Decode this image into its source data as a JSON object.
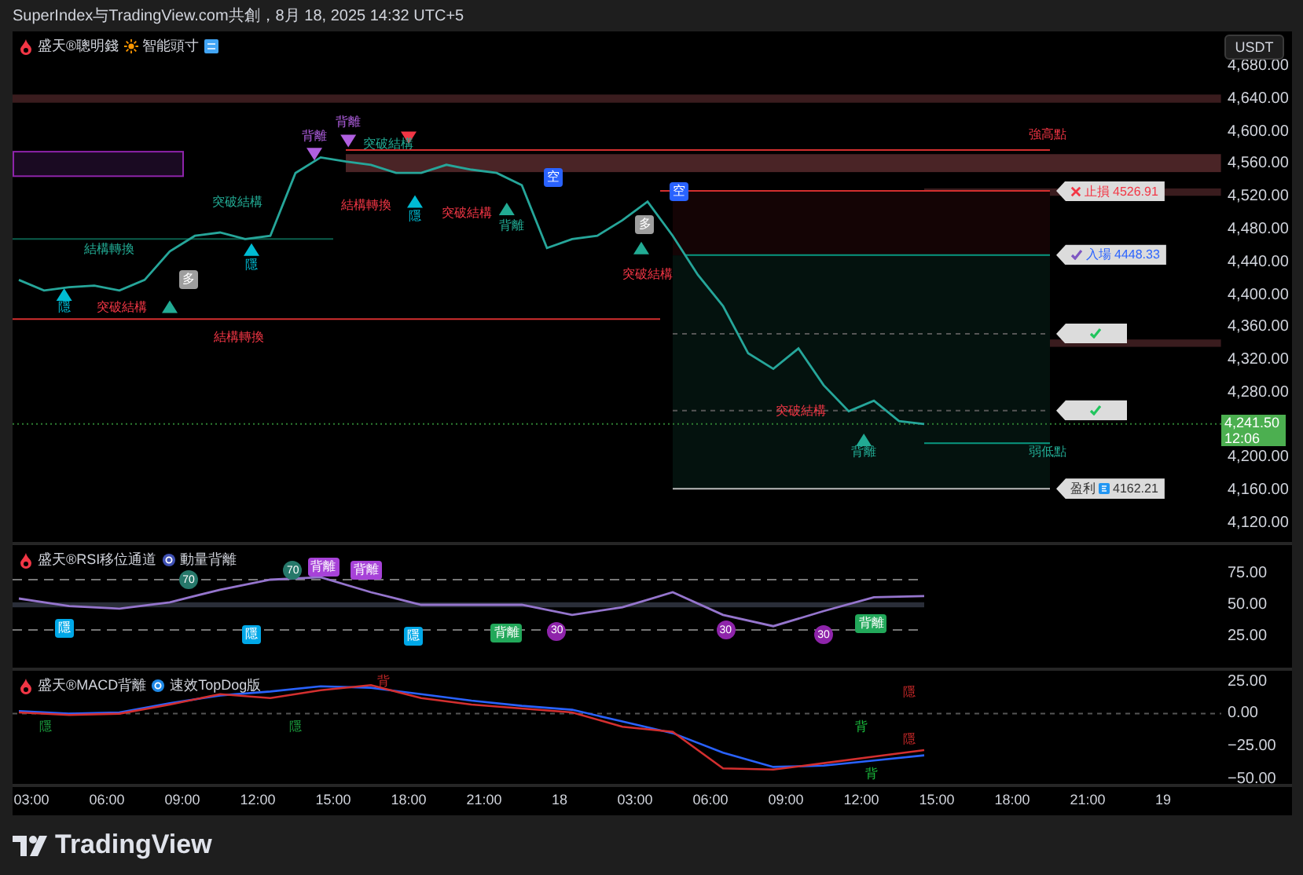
{
  "header": {
    "text": "SuperIndex与TradingView.com共創，8月 18, 2025 14:32 UTC+5"
  },
  "price_panel": {
    "legend": {
      "name": "盛天®聰明錢",
      "setting": "智能頭寸"
    },
    "currency_button": "USDT",
    "price_tag": {
      "price": "4,241.50",
      "countdown": "12:06"
    },
    "axis_labels": [
      "4,680.00",
      "4,640.00",
      "4,600.00",
      "4,560.00",
      "4,520.00",
      "4,480.00",
      "4,440.00",
      "4,400.00",
      "4,360.00",
      "4,320.00",
      "4,280.00",
      "4,200.00",
      "4,160.00",
      "4,120.00"
    ],
    "signals": [
      {
        "kind": "label",
        "text": "背離",
        "color": "#b05fe0"
      },
      {
        "kind": "down-arrow",
        "color": "#b05fe0"
      },
      {
        "kind": "label",
        "text": "背離",
        "color": "#b05fe0"
      },
      {
        "kind": "down-arrow",
        "color": "#b05fe0"
      },
      {
        "kind": "label",
        "text": "突破結構",
        "color": "#22ab94"
      },
      {
        "kind": "down-arrow",
        "color": "#f23645"
      },
      {
        "kind": "label",
        "text": "突破結構",
        "color": "#22ab94"
      },
      {
        "kind": "label",
        "text": "結構轉換",
        "color": "#22ab94"
      },
      {
        "kind": "up-arrow",
        "color": "#00bcd4"
      },
      {
        "kind": "label",
        "text": "隱",
        "color": "#00bcd4"
      },
      {
        "kind": "label",
        "text": "突破結構",
        "color": "#f23645"
      },
      {
        "kind": "up-arrow",
        "color": "#22ab94"
      },
      {
        "kind": "tag",
        "text": "多",
        "color": "#9e9e9e"
      },
      {
        "kind": "up-arrow",
        "color": "#00bcd4"
      },
      {
        "kind": "label",
        "text": "隱",
        "color": "#00bcd4"
      },
      {
        "kind": "label",
        "text": "結構轉換",
        "color": "#f23645"
      },
      {
        "kind": "label",
        "text": "結構轉換",
        "color": "#f23645"
      },
      {
        "kind": "up-arrow",
        "color": "#00bcd4"
      },
      {
        "kind": "label",
        "text": "隱",
        "color": "#00bcd4"
      },
      {
        "kind": "label",
        "text": "突破結構",
        "color": "#f23645"
      },
      {
        "kind": "up-arrow",
        "color": "#22ab94"
      },
      {
        "kind": "label",
        "text": "背離",
        "color": "#22ab94"
      },
      {
        "kind": "tag",
        "text": "空",
        "color": "#2962ff"
      },
      {
        "kind": "tag",
        "text": "多",
        "color": "#9e9e9e"
      },
      {
        "kind": "up-arrow",
        "color": "#22ab94"
      },
      {
        "kind": "tag",
        "text": "空",
        "color": "#2962ff"
      },
      {
        "kind": "label",
        "text": "突破結構",
        "color": "#f23645"
      },
      {
        "kind": "label",
        "text": "突破結構",
        "color": "#f23645"
      },
      {
        "kind": "up-arrow",
        "color": "#22ab94"
      },
      {
        "kind": "label",
        "text": "背離",
        "color": "#22ab94"
      },
      {
        "kind": "label",
        "text": "強高點",
        "color": "#f23645"
      },
      {
        "kind": "label",
        "text": "弱低點",
        "color": "#22ab94"
      }
    ],
    "level_tags": [
      {
        "kind": "stop",
        "label": "止損",
        "value": "4526.91"
      },
      {
        "kind": "entry",
        "label": "入場",
        "value": "4448.33"
      },
      {
        "kind": "target"
      },
      {
        "kind": "target"
      },
      {
        "kind": "profit",
        "label": "盈利",
        "value": "4162.21"
      }
    ]
  },
  "rsi_panel": {
    "legend": {
      "name": "盛天®RSI移位通道",
      "setting": "動量背離"
    },
    "axis_labels": [
      "75.00",
      "50.00",
      "25.00"
    ],
    "signals": [
      {
        "kind": "tag",
        "text": "隱",
        "color": "#00a8e8"
      },
      {
        "kind": "circle",
        "text": "70",
        "color": "#26786a"
      },
      {
        "kind": "circle",
        "text": "70",
        "color": "#26786a"
      },
      {
        "kind": "tag",
        "text": "背離",
        "color": "#a742d8"
      },
      {
        "kind": "tag",
        "text": "背離",
        "color": "#a742d8"
      },
      {
        "kind": "tag",
        "text": "隱",
        "color": "#00a8e8"
      },
      {
        "kind": "tag",
        "text": "隱",
        "color": "#00a8e8"
      },
      {
        "kind": "tag",
        "text": "背離",
        "color": "#22a85a"
      },
      {
        "kind": "circle",
        "text": "30",
        "color": "#8e24aa"
      },
      {
        "kind": "circle",
        "text": "30",
        "color": "#8e24aa"
      },
      {
        "kind": "circle",
        "text": "30",
        "color": "#8e24aa"
      },
      {
        "kind": "tag",
        "text": "背離",
        "color": "#22a85a"
      }
    ]
  },
  "macd_panel": {
    "legend": {
      "name": "盛天®MACD背離",
      "setting": "速效TopDog版"
    },
    "axis_labels": [
      "25.00",
      "0.00",
      "−25.00",
      "−50.00"
    ],
    "signals": [
      {
        "kind": "label",
        "text": "隱",
        "color": "#1b9e3e"
      },
      {
        "kind": "label",
        "text": "隱",
        "color": "#1b9e3e"
      },
      {
        "kind": "label",
        "text": "背",
        "color": "#c62828"
      },
      {
        "kind": "label",
        "text": "隱",
        "color": "#c62828"
      },
      {
        "kind": "label",
        "text": "背",
        "color": "#1bbf3e"
      },
      {
        "kind": "label",
        "text": "隱",
        "color": "#c62828"
      },
      {
        "kind": "label",
        "text": "背",
        "color": "#1bbf3e"
      }
    ]
  },
  "time_axis": {
    "labels": [
      "03:00",
      "06:00",
      "09:00",
      "12:00",
      "15:00",
      "18:00",
      "21:00",
      "18",
      "03:00",
      "06:00",
      "09:00",
      "12:00",
      "15:00",
      "18:00",
      "21:00",
      "19"
    ]
  },
  "footer": {
    "brand": "TradingView"
  }
}
